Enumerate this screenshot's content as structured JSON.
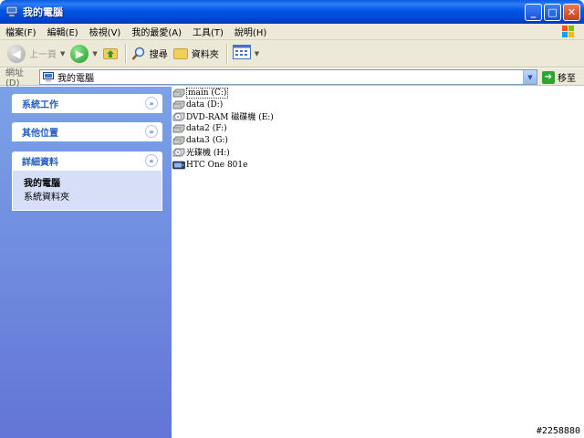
{
  "window": {
    "title": "我的電腦",
    "watermark": "#2258880"
  },
  "menu": [
    "檔案(F)",
    "編輯(E)",
    "檢視(V)",
    "我的最愛(A)",
    "工具(T)",
    "說明(H)"
  ],
  "toolbar": {
    "back_label": "上一頁",
    "search_label": "搜尋",
    "folders_label": "資料夾"
  },
  "address": {
    "label": "網址(D)",
    "value": "我的電腦",
    "go_label": "移至"
  },
  "sidebar": {
    "system_tasks": "系統工作",
    "other_places": "其他位置",
    "details": {
      "title": "詳細資料",
      "name": "我的電腦",
      "type": "系統資料夾"
    }
  },
  "drives": [
    {
      "label": "main (C:)",
      "icon": "hard-drive-icon"
    },
    {
      "label": "data (D:)",
      "icon": "hard-drive-icon"
    },
    {
      "label": "DVD-RAM 磁碟機 (E:)",
      "icon": "optical-drive-icon"
    },
    {
      "label": "data2 (F:)",
      "icon": "hard-drive-icon"
    },
    {
      "label": "data3 (G:)",
      "icon": "hard-drive-icon"
    },
    {
      "label": "光碟機 (H:)",
      "icon": "optical-drive-icon"
    },
    {
      "label": "HTC One 801e",
      "icon": "phone-device-icon"
    }
  ],
  "colors": {
    "title_bar": "#0055e5",
    "sidebar_top": "#7ba2e7",
    "sidebar_bottom": "#6375d6",
    "panel_heading": "#215dc6"
  }
}
